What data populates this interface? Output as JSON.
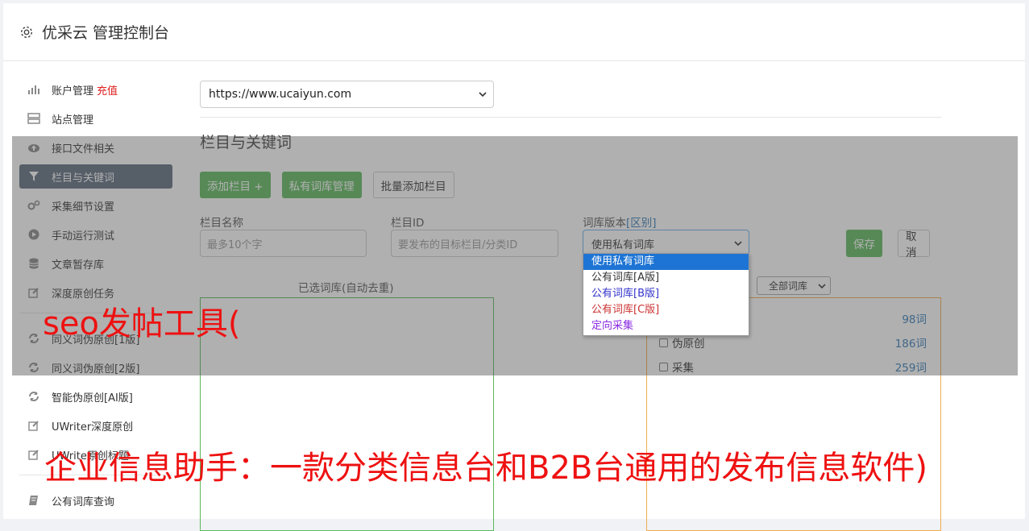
{
  "header": {
    "title": "优采云 管理控制台",
    "icon": "gear-icon"
  },
  "sidebar": {
    "items": [
      {
        "label": "账户管理",
        "extra": "充值",
        "icon": "bar-chart-icon"
      },
      {
        "label": "站点管理",
        "icon": "server-icon"
      },
      {
        "label": "接口文件相关",
        "icon": "cloud-upload-icon"
      },
      {
        "label": "栏目与关键词",
        "icon": "filter-icon"
      },
      {
        "label": "采集细节设置",
        "icon": "gears-icon"
      },
      {
        "label": "手动运行测试",
        "icon": "play-circle-icon"
      },
      {
        "label": "文章暂存库",
        "icon": "database-icon"
      },
      {
        "label": "深度原创任务",
        "icon": "edit-icon"
      },
      {
        "label": "同义词伪原创[1版]",
        "icon": "refresh-icon"
      },
      {
        "label": "同义词伪原创[2版]",
        "icon": "refresh-icon"
      },
      {
        "label": "智能伪原创[AI版]",
        "icon": "refresh-icon"
      },
      {
        "label": "UWriter深度原创",
        "icon": "edit-icon"
      },
      {
        "label": "UWrite原创标题",
        "icon": "edit-icon"
      },
      {
        "label": "公有词库查询",
        "icon": "book-icon"
      }
    ]
  },
  "site_select": {
    "value": "https://www.ucaiyun.com"
  },
  "section": {
    "title": "栏目与关键词"
  },
  "buttons": {
    "add_column": "添加栏目 +",
    "private_lib": "私有词库管理",
    "batch_add": "批量添加栏目",
    "save": "保存",
    "cancel": "取消"
  },
  "form": {
    "name_label": "栏目名称",
    "name_placeholder": "最多10个字",
    "id_label": "栏目ID",
    "id_placeholder": "要发布的目标栏目/分类ID",
    "version_label": "词库版本",
    "version_link": "[区别]",
    "version_value": "使用私有词库"
  },
  "dropdown": {
    "options": [
      {
        "label": "使用私有词库",
        "color": "#ffffff"
      },
      {
        "label": "公有词库[A版]",
        "color": "#333333"
      },
      {
        "label": "公有词库[B版]",
        "color": "#3333cc"
      },
      {
        "label": "公有词库[C版]",
        "color": "#cc3333"
      },
      {
        "label": "定向采集",
        "color": "#8a2be2"
      }
    ]
  },
  "libs": {
    "selected_label": "已选词库(自动去重)",
    "filter_value": "全部词库",
    "rows": [
      {
        "label": "",
        "count": "98词"
      },
      {
        "label": "伪原创",
        "count": "186词"
      },
      {
        "label": "采集",
        "count": "259词"
      }
    ]
  },
  "watermark": {
    "line1": "seo发帖工具(",
    "line2": "企业信息助手：一款分类信息台和B2B台通用的发布信息软件)"
  }
}
